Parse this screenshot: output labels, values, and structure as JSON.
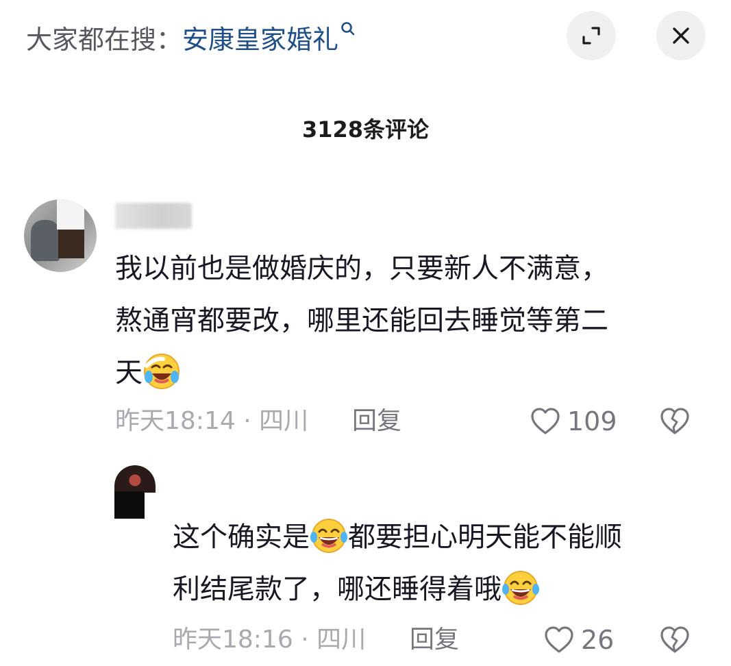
{
  "search_hint": {
    "prefix": "大家都在搜：",
    "term": "安康皇家婚礼"
  },
  "header": {
    "comment_count": "3128条评论"
  },
  "main_comment": {
    "text_lines": [
      "我以前也是做婚庆的，只要新人不满意，",
      "熬通宵都要改，哪里还能回去睡觉等第二",
      "天"
    ],
    "emoji": "crying-laughing-emoji",
    "timestamp": "昨天18:14 · 四川",
    "reply_label": "回复",
    "like_count": "109"
  },
  "reply_comment": {
    "line1_before": "这个确实是",
    "line1_after": "都要担心明天能不能顺",
    "line2": "利结尾款了，哪还睡得着哦",
    "emoji": "tears-of-joy-emoji",
    "timestamp": "昨天18:16 · 四川",
    "reply_label": "回复",
    "like_count": "26"
  },
  "colors": {
    "search_term": "#1f4f88",
    "text_primary": "#161823",
    "text_secondary": "#a9aab0",
    "button_bg": "#eff0f2"
  },
  "icons": {
    "expand": "expand-icon",
    "close": "close-icon",
    "like": "heart-icon",
    "dislike": "broken-heart-icon",
    "search": "search-icon"
  }
}
